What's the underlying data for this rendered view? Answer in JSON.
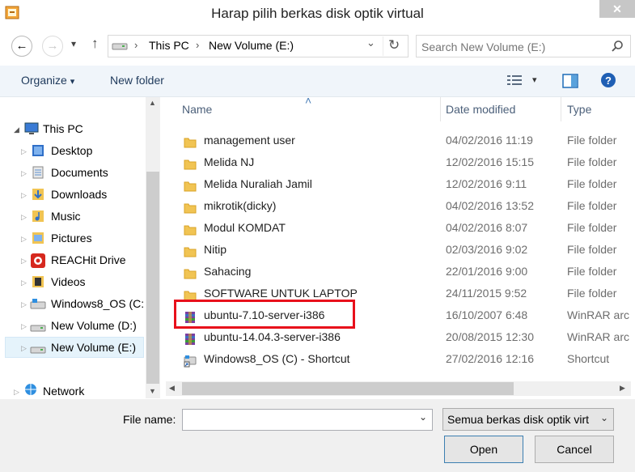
{
  "window": {
    "title": "Harap pilih berkas disk optik virtual",
    "close_glyph": "✕"
  },
  "nav": {
    "back_glyph": "←",
    "forward_glyph": "→",
    "dropdown_glyph": "▾",
    "up_glyph": "↑",
    "refresh_glyph": "↻"
  },
  "address": {
    "crumbs": [
      "This PC",
      "New Volume (E:)"
    ],
    "separator_glyph": "›",
    "dropdown_glyph": "⌄"
  },
  "search": {
    "placeholder": "Search New Volume (E:)",
    "icon": "search-icon"
  },
  "toolbar": {
    "organize_label": "Organize",
    "organize_caret": "▾",
    "new_folder_label": "New folder"
  },
  "nav_pane": {
    "this_pc": "This PC",
    "items": [
      {
        "label": "Desktop",
        "icon": "desktop-icon"
      },
      {
        "label": "Documents",
        "icon": "documents-icon"
      },
      {
        "label": "Downloads",
        "icon": "downloads-icon"
      },
      {
        "label": "Music",
        "icon": "music-icon"
      },
      {
        "label": "Pictures",
        "icon": "pictures-icon"
      },
      {
        "label": "REACHit Drive",
        "icon": "reachit-icon"
      },
      {
        "label": "Videos",
        "icon": "videos-icon"
      },
      {
        "label": "Windows8_OS (C:",
        "icon": "os-drive-icon"
      },
      {
        "label": "New Volume (D:)",
        "icon": "drive-icon"
      },
      {
        "label": "New Volume (E:)",
        "icon": "drive-icon",
        "selected": true
      }
    ],
    "network": "Network"
  },
  "file_list": {
    "columns": [
      "Name",
      "Date modified",
      "Type"
    ],
    "sort_glyph": "˄",
    "rows": [
      {
        "name": "management user",
        "date": "04/02/2016 11:19",
        "type": "File folder",
        "icon": "folder-icon"
      },
      {
        "name": "Melida NJ",
        "date": "12/02/2016 15:15",
        "type": "File folder",
        "icon": "folder-icon"
      },
      {
        "name": "Melida Nuraliah Jamil",
        "date": "12/02/2016 9:11",
        "type": "File folder",
        "icon": "folder-icon"
      },
      {
        "name": "mikrotik(dicky)",
        "date": "04/02/2016 13:52",
        "type": "File folder",
        "icon": "folder-icon"
      },
      {
        "name": "Modul KOMDAT",
        "date": "04/02/2016 8:07",
        "type": "File folder",
        "icon": "folder-icon"
      },
      {
        "name": "Nitip",
        "date": "02/03/2016 9:02",
        "type": "File folder",
        "icon": "folder-icon"
      },
      {
        "name": "Sahacing",
        "date": "22/01/2016 9:00",
        "type": "File folder",
        "icon": "folder-icon"
      },
      {
        "name": "SOFTWARE UNTUK LAPTOP",
        "date": "24/11/2015 9:52",
        "type": "File folder",
        "icon": "folder-icon"
      },
      {
        "name": "ubuntu-7.10-server-i386",
        "date": "16/10/2007 6:48",
        "type": "WinRAR arc",
        "icon": "winrar-icon",
        "highlighted": true
      },
      {
        "name": "ubuntu-14.04.3-server-i386",
        "date": "20/08/2015 12:30",
        "type": "WinRAR arc",
        "icon": "winrar-icon"
      },
      {
        "name": "Windows8_OS (C) - Shortcut",
        "date": "27/02/2016 12:16",
        "type": "Shortcut",
        "icon": "shortcut-icon"
      }
    ]
  },
  "footer": {
    "file_name_label": "File name:",
    "file_name_value": "",
    "filter_value": "Semua berkas disk optik virt",
    "open_label": "Open",
    "cancel_label": "Cancel"
  },
  "colors": {
    "highlight_border": "#e8101b",
    "selected_nav": "#e5f3fb",
    "folder": "#f1c453"
  }
}
